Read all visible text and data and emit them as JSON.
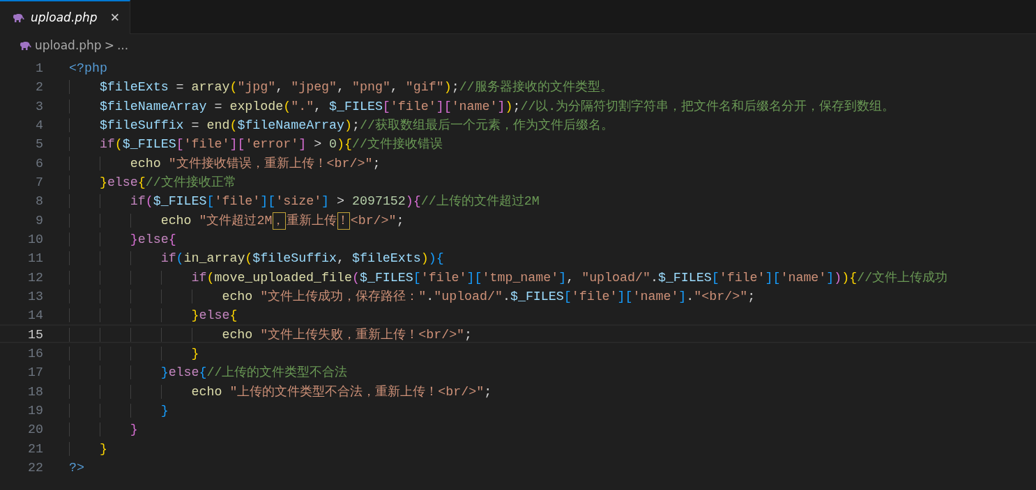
{
  "tabs": [
    {
      "label": "upload.php",
      "selected": true,
      "close": "✕"
    }
  ],
  "breadcrumb": {
    "file": "upload.php",
    "separator": ">",
    "rest": "..."
  },
  "lines": [
    {
      "number": "1",
      "selected": false,
      "tokens": [
        {
          "kind": "tag",
          "text": "<?php"
        }
      ]
    },
    {
      "number": "2",
      "selected": false,
      "tokens": [
        {
          "kind": "variable",
          "text": "    $fileExts"
        },
        {
          "kind": "plain",
          "text": " = "
        },
        {
          "kind": "function",
          "text": "array"
        },
        {
          "kind": "bracket",
          "text": "(",
          "color": "#ffd700"
        },
        {
          "kind": "string",
          "text": "\"jpg\""
        },
        {
          "kind": "plain",
          "text": ", "
        },
        {
          "kind": "string",
          "text": "\"jpeg\""
        },
        {
          "kind": "plain",
          "text": ", "
        },
        {
          "kind": "string",
          "text": "\"png\""
        },
        {
          "kind": "plain",
          "text": ", "
        },
        {
          "kind": "string",
          "text": "\"gif\""
        },
        {
          "kind": "bracket",
          "text": ")",
          "color": "#ffd700"
        },
        {
          "kind": "plain",
          "text": ";"
        },
        {
          "kind": "comment",
          "text": "//服务器接收的文件类型。"
        }
      ]
    },
    {
      "number": "3",
      "selected": false,
      "tokens": [
        {
          "kind": "variable",
          "text": "    $fileNameArray"
        },
        {
          "kind": "plain",
          "text": " = "
        },
        {
          "kind": "function",
          "text": "explode"
        },
        {
          "kind": "bracket",
          "text": "(",
          "color": "#ffd700"
        },
        {
          "kind": "string",
          "text": "\".\""
        },
        {
          "kind": "plain",
          "text": ", "
        },
        {
          "kind": "variable",
          "text": "$_FILES"
        },
        {
          "kind": "bracket",
          "text": "[",
          "color": "#da70d6"
        },
        {
          "kind": "string",
          "text": "'file'"
        },
        {
          "kind": "bracket",
          "text": "]",
          "color": "#da70d6"
        },
        {
          "kind": "bracket",
          "text": "[",
          "color": "#da70d6"
        },
        {
          "kind": "string",
          "text": "'name'"
        },
        {
          "kind": "bracket",
          "text": "]",
          "color": "#da70d6"
        },
        {
          "kind": "bracket",
          "text": ")",
          "color": "#ffd700"
        },
        {
          "kind": "plain",
          "text": ";"
        },
        {
          "kind": "comment",
          "text": "//以.为分隔符切割字符串，把文件名和后缀名分开，保存到数组。"
        }
      ]
    },
    {
      "number": "4",
      "selected": false,
      "tokens": [
        {
          "kind": "variable",
          "text": "    $fileSuffix"
        },
        {
          "kind": "plain",
          "text": " = "
        },
        {
          "kind": "function",
          "text": "end"
        },
        {
          "kind": "bracket",
          "text": "(",
          "color": "#ffd700"
        },
        {
          "kind": "variable",
          "text": "$fileNameArray"
        },
        {
          "kind": "bracket",
          "text": ")",
          "color": "#ffd700"
        },
        {
          "kind": "plain",
          "text": ";"
        },
        {
          "kind": "comment",
          "text": "//获取数组最后一个元素，作为文件后缀名。"
        }
      ]
    },
    {
      "number": "5",
      "selected": false,
      "tokens": [
        {
          "kind": "keyword",
          "text": "    if"
        },
        {
          "kind": "bracket",
          "text": "(",
          "color": "#ffd700"
        },
        {
          "kind": "variable",
          "text": "$_FILES"
        },
        {
          "kind": "bracket",
          "text": "[",
          "color": "#da70d6"
        },
        {
          "kind": "string",
          "text": "'file'"
        },
        {
          "kind": "bracket",
          "text": "]",
          "color": "#da70d6"
        },
        {
          "kind": "bracket",
          "text": "[",
          "color": "#da70d6"
        },
        {
          "kind": "string",
          "text": "'error'"
        },
        {
          "kind": "bracket",
          "text": "]",
          "color": "#da70d6"
        },
        {
          "kind": "plain",
          "text": " > "
        },
        {
          "kind": "number",
          "text": "0"
        },
        {
          "kind": "bracket",
          "text": ")",
          "color": "#ffd700"
        },
        {
          "kind": "bracket",
          "text": "{",
          "color": "#ffd700"
        },
        {
          "kind": "comment",
          "text": "//文件接收错误"
        }
      ]
    },
    {
      "number": "6",
      "selected": false,
      "tokens": [
        {
          "kind": "echo",
          "text": "        echo"
        },
        {
          "kind": "string",
          "text": " \"文件接收错误，重新上传！<br/>\""
        },
        {
          "kind": "plain",
          "text": ";"
        }
      ]
    },
    {
      "number": "7",
      "selected": false,
      "tokens": [
        {
          "kind": "bracket",
          "text": "    }",
          "color": "#ffd700"
        },
        {
          "kind": "keyword",
          "text": "else"
        },
        {
          "kind": "bracket",
          "text": "{",
          "color": "#ffd700"
        },
        {
          "kind": "comment",
          "text": "//文件接收正常"
        }
      ]
    },
    {
      "number": "8",
      "selected": false,
      "tokens": [
        {
          "kind": "keyword",
          "text": "        if"
        },
        {
          "kind": "bracket",
          "text": "(",
          "color": "#da70d6"
        },
        {
          "kind": "variable",
          "text": "$_FILES"
        },
        {
          "kind": "bracket",
          "text": "[",
          "color": "#179fff"
        },
        {
          "kind": "string",
          "text": "'file'"
        },
        {
          "kind": "bracket",
          "text": "]",
          "color": "#179fff"
        },
        {
          "kind": "bracket",
          "text": "[",
          "color": "#179fff"
        },
        {
          "kind": "string",
          "text": "'size'"
        },
        {
          "kind": "bracket",
          "text": "]",
          "color": "#179fff"
        },
        {
          "kind": "plain",
          "text": " > "
        },
        {
          "kind": "number",
          "text": "2097152"
        },
        {
          "kind": "bracket",
          "text": ")",
          "color": "#da70d6"
        },
        {
          "kind": "bracket",
          "text": "{",
          "color": "#da70d6"
        },
        {
          "kind": "comment",
          "text": "//上传的文件超过2M"
        }
      ]
    },
    {
      "number": "9",
      "selected": false,
      "tokens": [
        {
          "kind": "echo",
          "text": "            echo"
        },
        {
          "kind": "string",
          "text": " \"文件超过2M",
          "flagged": false
        },
        {
          "kind": "string",
          "text": "，",
          "flagged": true
        },
        {
          "kind": "string",
          "text": "重新上传",
          "flagged": false
        },
        {
          "kind": "string",
          "text": "！",
          "flagged": true
        },
        {
          "kind": "string",
          "text": "<br/>\"",
          "flagged": false
        },
        {
          "kind": "plain",
          "text": ";"
        }
      ]
    },
    {
      "number": "10",
      "selected": false,
      "tokens": [
        {
          "kind": "bracket",
          "text": "        }",
          "color": "#da70d6"
        },
        {
          "kind": "keyword",
          "text": "else"
        },
        {
          "kind": "bracket",
          "text": "{",
          "color": "#da70d6"
        }
      ]
    },
    {
      "number": "11",
      "selected": false,
      "tokens": [
        {
          "kind": "keyword",
          "text": "            if"
        },
        {
          "kind": "bracket",
          "text": "(",
          "color": "#179fff"
        },
        {
          "kind": "function",
          "text": "in_array"
        },
        {
          "kind": "bracket",
          "text": "(",
          "color": "#ffd700"
        },
        {
          "kind": "variable",
          "text": "$fileSuffix"
        },
        {
          "kind": "plain",
          "text": ", "
        },
        {
          "kind": "variable",
          "text": "$fileExts"
        },
        {
          "kind": "bracket",
          "text": ")",
          "color": "#ffd700"
        },
        {
          "kind": "bracket",
          "text": ")",
          "color": "#179fff"
        },
        {
          "kind": "bracket",
          "text": "{",
          "color": "#179fff"
        }
      ]
    },
    {
      "number": "12",
      "selected": false,
      "tokens": [
        {
          "kind": "keyword",
          "text": "                if"
        },
        {
          "kind": "bracket",
          "text": "(",
          "color": "#ffd700"
        },
        {
          "kind": "function",
          "text": "move_uploaded_file"
        },
        {
          "kind": "bracket",
          "text": "(",
          "color": "#da70d6"
        },
        {
          "kind": "variable",
          "text": "$_FILES"
        },
        {
          "kind": "bracket",
          "text": "[",
          "color": "#179fff"
        },
        {
          "kind": "string",
          "text": "'file'"
        },
        {
          "kind": "bracket",
          "text": "]",
          "color": "#179fff"
        },
        {
          "kind": "bracket",
          "text": "[",
          "color": "#179fff"
        },
        {
          "kind": "string",
          "text": "'tmp_name'"
        },
        {
          "kind": "bracket",
          "text": "]",
          "color": "#179fff"
        },
        {
          "kind": "plain",
          "text": ", "
        },
        {
          "kind": "string",
          "text": "\"upload/\""
        },
        {
          "kind": "plain",
          "text": "."
        },
        {
          "kind": "variable",
          "text": "$_FILES"
        },
        {
          "kind": "bracket",
          "text": "[",
          "color": "#179fff"
        },
        {
          "kind": "string",
          "text": "'file'"
        },
        {
          "kind": "bracket",
          "text": "]",
          "color": "#179fff"
        },
        {
          "kind": "bracket",
          "text": "[",
          "color": "#179fff"
        },
        {
          "kind": "string",
          "text": "'name'"
        },
        {
          "kind": "bracket",
          "text": "]",
          "color": "#179fff"
        },
        {
          "kind": "bracket",
          "text": ")",
          "color": "#da70d6"
        },
        {
          "kind": "bracket",
          "text": ")",
          "color": "#ffd700"
        },
        {
          "kind": "bracket",
          "text": "{",
          "color": "#ffd700"
        },
        {
          "kind": "comment",
          "text": "//文件上传成功"
        }
      ]
    },
    {
      "number": "13",
      "selected": false,
      "tokens": [
        {
          "kind": "echo",
          "text": "                    echo"
        },
        {
          "kind": "string",
          "text": " \"文件上传成功，保存路径：\""
        },
        {
          "kind": "plain",
          "text": "."
        },
        {
          "kind": "string",
          "text": "\"upload/\""
        },
        {
          "kind": "plain",
          "text": "."
        },
        {
          "kind": "variable",
          "text": "$_FILES"
        },
        {
          "kind": "bracket",
          "text": "[",
          "color": "#179fff"
        },
        {
          "kind": "string",
          "text": "'file'"
        },
        {
          "kind": "bracket",
          "text": "]",
          "color": "#179fff"
        },
        {
          "kind": "bracket",
          "text": "[",
          "color": "#179fff"
        },
        {
          "kind": "string",
          "text": "'name'"
        },
        {
          "kind": "bracket",
          "text": "]",
          "color": "#179fff"
        },
        {
          "kind": "plain",
          "text": "."
        },
        {
          "kind": "string",
          "text": "\"<br/>\""
        },
        {
          "kind": "plain",
          "text": ";"
        }
      ]
    },
    {
      "number": "14",
      "selected": false,
      "tokens": [
        {
          "kind": "bracket",
          "text": "                }",
          "color": "#ffd700"
        },
        {
          "kind": "keyword",
          "text": "else"
        },
        {
          "kind": "bracket",
          "text": "{",
          "color": "#ffd700"
        }
      ]
    },
    {
      "number": "15",
      "selected": true,
      "tokens": [
        {
          "kind": "echo",
          "text": "                    echo"
        },
        {
          "kind": "string",
          "text": " \"文件上传失败，重新上传！<br/>\""
        },
        {
          "kind": "plain",
          "text": ";"
        }
      ]
    },
    {
      "number": "16",
      "selected": false,
      "tokens": [
        {
          "kind": "bracket",
          "text": "                }",
          "color": "#ffd700"
        }
      ]
    },
    {
      "number": "17",
      "selected": false,
      "tokens": [
        {
          "kind": "bracket",
          "text": "            }",
          "color": "#179fff"
        },
        {
          "kind": "keyword",
          "text": "else"
        },
        {
          "kind": "bracket",
          "text": "{",
          "color": "#179fff"
        },
        {
          "kind": "comment",
          "text": "//上传的文件类型不合法"
        }
      ]
    },
    {
      "number": "18",
      "selected": false,
      "tokens": [
        {
          "kind": "echo",
          "text": "                echo"
        },
        {
          "kind": "string",
          "text": " \"上传的文件类型不合法，重新上传！<br/>\""
        },
        {
          "kind": "plain",
          "text": ";"
        }
      ]
    },
    {
      "number": "19",
      "selected": false,
      "tokens": [
        {
          "kind": "bracket",
          "text": "            }",
          "color": "#179fff"
        }
      ]
    },
    {
      "number": "20",
      "selected": false,
      "tokens": [
        {
          "kind": "bracket",
          "text": "        }",
          "color": "#da70d6"
        }
      ]
    },
    {
      "number": "21",
      "selected": false,
      "tokens": [
        {
          "kind": "bracket",
          "text": "    }",
          "color": "#ffd700"
        }
      ]
    },
    {
      "number": "22",
      "selected": false,
      "tokens": [
        {
          "kind": "tag",
          "text": "?>"
        }
      ]
    }
  ]
}
